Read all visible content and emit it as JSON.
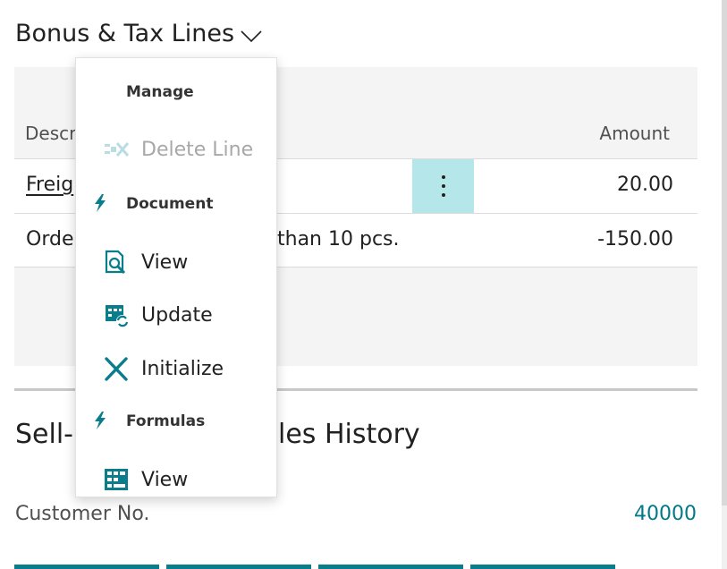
{
  "section": {
    "title": "Bonus & Tax Lines"
  },
  "lines_table": {
    "columns": {
      "description": "Descri",
      "amount": "Amount"
    },
    "rows": [
      {
        "description_visible": "Freig",
        "description_tail": "",
        "amount": "20.00"
      },
      {
        "description_visible": "Orde",
        "description_tail": "than 10 pcs.",
        "amount": "-150.00"
      }
    ]
  },
  "section2": {
    "title_head": "Sell-",
    "title_tail": "les History"
  },
  "customer_field": {
    "label": "Customer No.",
    "value": "40000"
  },
  "context_menu": {
    "group_manage": {
      "label": "Manage"
    },
    "delete_line": {
      "label": "Delete Line",
      "disabled": true
    },
    "group_document": {
      "label": "Document"
    },
    "doc_view": {
      "label": "View"
    },
    "doc_update": {
      "label": "Update"
    },
    "doc_initialize": {
      "label": "Initialize"
    },
    "group_formulas": {
      "label": "Formulas"
    },
    "formulas_view": {
      "label": "View"
    }
  },
  "colors": {
    "accent": "#00798a",
    "row_menu_highlight": "#b5e6ea",
    "panel_bg": "#f4f4f5",
    "tile": "#0a7d8c"
  },
  "icons": {
    "section_toggle": "chevron-down-icon",
    "row_menu": "more-vertical-icon",
    "delete_line": "delete-row-icon",
    "group_lightning": "lightning-icon",
    "doc_view": "search-document-icon",
    "doc_update": "refresh-grid-icon",
    "doc_initialize": "x-icon",
    "formulas_view": "grid-icon"
  }
}
